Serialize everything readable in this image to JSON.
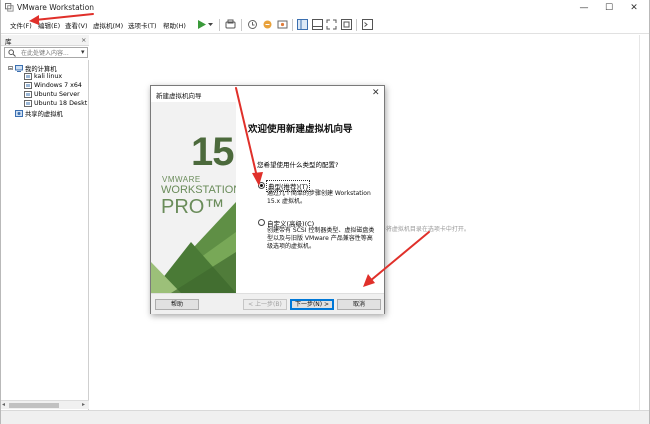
{
  "window": {
    "title": "VMware Workstation",
    "controls": {
      "minimize": "—",
      "maximize": "☐",
      "close": "✕"
    }
  },
  "menubar": {
    "items": [
      "文件(F)",
      "编辑(E)",
      "查看(V)",
      "虚拟机(M)",
      "选项卡(T)",
      "帮助(H)"
    ],
    "toolbar_icons": [
      "play-icon",
      "dropdown-icon",
      "send-keys-icon",
      "snapshot-icon",
      "revert-snapshot-icon",
      "manage-snapshots-icon",
      "library-view-icon",
      "thumbnail-bar-icon",
      "fullscreen-icon",
      "unity-icon",
      "console-icon"
    ]
  },
  "library": {
    "title": "库",
    "close": "×",
    "search_placeholder": "在此处键入内容...",
    "tree": {
      "my_computer": "我的计算机",
      "vms": [
        "kali linux",
        "Windows 7 x64",
        "Ubuntu Server",
        "Ubuntu 18 Deskt"
      ],
      "shared": "共享的虚拟机"
    }
  },
  "main": {
    "hint_text": "·将虚拟机目录在选项卡中打开。"
  },
  "dialog": {
    "title": "新建虚拟机向导",
    "close": "✕",
    "banner": {
      "version": "15",
      "brand": "VMWARE",
      "product": "WORKSTATION",
      "edition": "PRO™"
    },
    "heading": "欢迎使用新建虚拟机向导",
    "question": "您希望使用什么类型的配置?",
    "options": [
      {
        "label": "典型(推荐)(T)",
        "selected": true,
        "description": [
          "通过几个简单的步骤创建 Workstation",
          "15.x 虚拟机。"
        ]
      },
      {
        "label": "自定义(高级)(C)",
        "selected": false,
        "description": [
          "创建带有 SCSI 控制器类型、虚拟磁盘类",
          "型以及与旧版 VMware 产品兼容性等高",
          "级选项的虚拟机。"
        ]
      }
    ],
    "buttons": {
      "help": "帮助",
      "back": "< 上一步(B)",
      "next": "下一步(N) >",
      "cancel": "取消"
    }
  },
  "colors": {
    "annotation_red": "#e0302a",
    "banner_green": "#4c6a3c",
    "accent_blue": "#0078d7"
  }
}
